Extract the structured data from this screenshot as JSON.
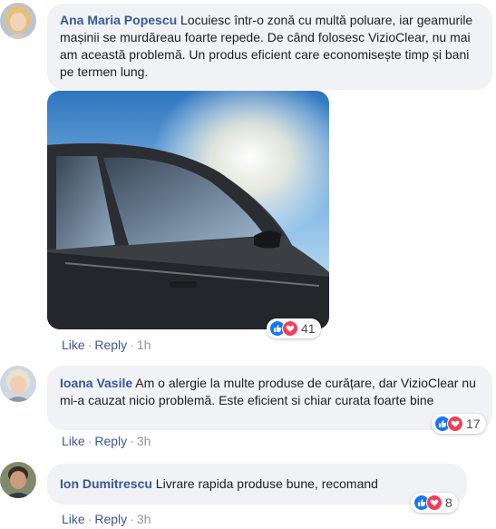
{
  "comments": [
    {
      "author": "Ana Maria Popescu",
      "text": "Locuiesc într-o zonă cu multă poluare, iar geamurile mașinii se murdăreau foarte repede. De când folosesc VizioClear, nu mai am această problemă. Un produs eficient care economisește timp și bani pe termen lung.",
      "reactions": {
        "count": "41",
        "icons": [
          "like-icon",
          "love-icon"
        ]
      },
      "actions": {
        "like": "Like",
        "reply": "Reply",
        "time": "1h"
      }
    },
    {
      "author": "Ioana Vasile",
      "text": "Am o alergie la multe produse de curățare, dar VizioClear nu mi-a cauzat nicio problemă. Este eficient si chiar curata foarte bine",
      "reactions": {
        "count": "17",
        "icons": [
          "like-icon",
          "love-icon"
        ]
      },
      "actions": {
        "like": "Like",
        "reply": "Reply",
        "time": "3h"
      }
    },
    {
      "author": "Ion Dumitrescu",
      "text": "Livrare rapida produse bune, recomand",
      "reactions": {
        "count": "8",
        "icons": [
          "like-icon",
          "love-icon"
        ]
      },
      "actions": {
        "like": "Like",
        "reply": "Reply",
        "time": "3h"
      }
    }
  ],
  "colors": {
    "name": "#385898",
    "bubble": "#f0f2f5",
    "like": "#1877f2",
    "love": "#f33e58"
  }
}
